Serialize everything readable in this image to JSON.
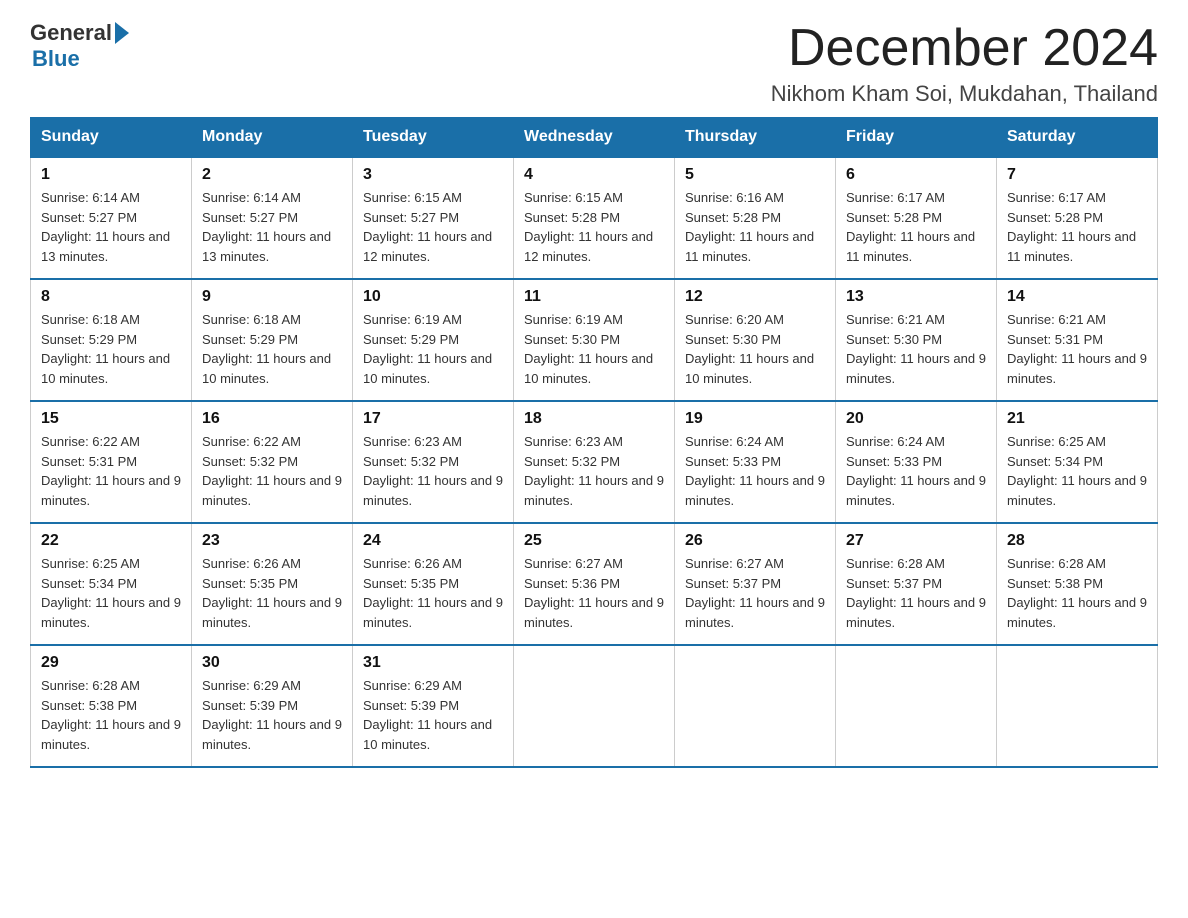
{
  "header": {
    "logo_general": "General",
    "logo_blue": "Blue",
    "month_title": "December 2024",
    "location": "Nikhom Kham Soi, Mukdahan, Thailand"
  },
  "days_of_week": [
    "Sunday",
    "Monday",
    "Tuesday",
    "Wednesday",
    "Thursday",
    "Friday",
    "Saturday"
  ],
  "weeks": [
    [
      {
        "day": "1",
        "sunrise": "6:14 AM",
        "sunset": "5:27 PM",
        "daylight": "11 hours and 13 minutes."
      },
      {
        "day": "2",
        "sunrise": "6:14 AM",
        "sunset": "5:27 PM",
        "daylight": "11 hours and 13 minutes."
      },
      {
        "day": "3",
        "sunrise": "6:15 AM",
        "sunset": "5:27 PM",
        "daylight": "11 hours and 12 minutes."
      },
      {
        "day": "4",
        "sunrise": "6:15 AM",
        "sunset": "5:28 PM",
        "daylight": "11 hours and 12 minutes."
      },
      {
        "day": "5",
        "sunrise": "6:16 AM",
        "sunset": "5:28 PM",
        "daylight": "11 hours and 11 minutes."
      },
      {
        "day": "6",
        "sunrise": "6:17 AM",
        "sunset": "5:28 PM",
        "daylight": "11 hours and 11 minutes."
      },
      {
        "day": "7",
        "sunrise": "6:17 AM",
        "sunset": "5:28 PM",
        "daylight": "11 hours and 11 minutes."
      }
    ],
    [
      {
        "day": "8",
        "sunrise": "6:18 AM",
        "sunset": "5:29 PM",
        "daylight": "11 hours and 10 minutes."
      },
      {
        "day": "9",
        "sunrise": "6:18 AM",
        "sunset": "5:29 PM",
        "daylight": "11 hours and 10 minutes."
      },
      {
        "day": "10",
        "sunrise": "6:19 AM",
        "sunset": "5:29 PM",
        "daylight": "11 hours and 10 minutes."
      },
      {
        "day": "11",
        "sunrise": "6:19 AM",
        "sunset": "5:30 PM",
        "daylight": "11 hours and 10 minutes."
      },
      {
        "day": "12",
        "sunrise": "6:20 AM",
        "sunset": "5:30 PM",
        "daylight": "11 hours and 10 minutes."
      },
      {
        "day": "13",
        "sunrise": "6:21 AM",
        "sunset": "5:30 PM",
        "daylight": "11 hours and 9 minutes."
      },
      {
        "day": "14",
        "sunrise": "6:21 AM",
        "sunset": "5:31 PM",
        "daylight": "11 hours and 9 minutes."
      }
    ],
    [
      {
        "day": "15",
        "sunrise": "6:22 AM",
        "sunset": "5:31 PM",
        "daylight": "11 hours and 9 minutes."
      },
      {
        "day": "16",
        "sunrise": "6:22 AM",
        "sunset": "5:32 PM",
        "daylight": "11 hours and 9 minutes."
      },
      {
        "day": "17",
        "sunrise": "6:23 AM",
        "sunset": "5:32 PM",
        "daylight": "11 hours and 9 minutes."
      },
      {
        "day": "18",
        "sunrise": "6:23 AM",
        "sunset": "5:32 PM",
        "daylight": "11 hours and 9 minutes."
      },
      {
        "day": "19",
        "sunrise": "6:24 AM",
        "sunset": "5:33 PM",
        "daylight": "11 hours and 9 minutes."
      },
      {
        "day": "20",
        "sunrise": "6:24 AM",
        "sunset": "5:33 PM",
        "daylight": "11 hours and 9 minutes."
      },
      {
        "day": "21",
        "sunrise": "6:25 AM",
        "sunset": "5:34 PM",
        "daylight": "11 hours and 9 minutes."
      }
    ],
    [
      {
        "day": "22",
        "sunrise": "6:25 AM",
        "sunset": "5:34 PM",
        "daylight": "11 hours and 9 minutes."
      },
      {
        "day": "23",
        "sunrise": "6:26 AM",
        "sunset": "5:35 PM",
        "daylight": "11 hours and 9 minutes."
      },
      {
        "day": "24",
        "sunrise": "6:26 AM",
        "sunset": "5:35 PM",
        "daylight": "11 hours and 9 minutes."
      },
      {
        "day": "25",
        "sunrise": "6:27 AM",
        "sunset": "5:36 PM",
        "daylight": "11 hours and 9 minutes."
      },
      {
        "day": "26",
        "sunrise": "6:27 AM",
        "sunset": "5:37 PM",
        "daylight": "11 hours and 9 minutes."
      },
      {
        "day": "27",
        "sunrise": "6:28 AM",
        "sunset": "5:37 PM",
        "daylight": "11 hours and 9 minutes."
      },
      {
        "day": "28",
        "sunrise": "6:28 AM",
        "sunset": "5:38 PM",
        "daylight": "11 hours and 9 minutes."
      }
    ],
    [
      {
        "day": "29",
        "sunrise": "6:28 AM",
        "sunset": "5:38 PM",
        "daylight": "11 hours and 9 minutes."
      },
      {
        "day": "30",
        "sunrise": "6:29 AM",
        "sunset": "5:39 PM",
        "daylight": "11 hours and 9 minutes."
      },
      {
        "day": "31",
        "sunrise": "6:29 AM",
        "sunset": "5:39 PM",
        "daylight": "11 hours and 10 minutes."
      },
      {
        "day": "",
        "sunrise": "",
        "sunset": "",
        "daylight": ""
      },
      {
        "day": "",
        "sunrise": "",
        "sunset": "",
        "daylight": ""
      },
      {
        "day": "",
        "sunrise": "",
        "sunset": "",
        "daylight": ""
      },
      {
        "day": "",
        "sunrise": "",
        "sunset": "",
        "daylight": ""
      }
    ]
  ],
  "labels": {
    "sunrise_prefix": "Sunrise: ",
    "sunset_prefix": "Sunset: ",
    "daylight_prefix": "Daylight: "
  }
}
